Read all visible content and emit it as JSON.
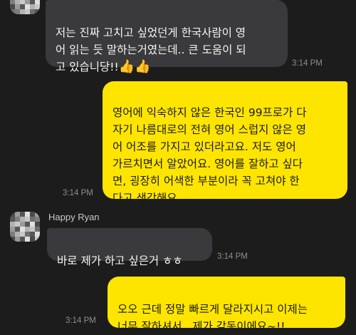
{
  "chat": {
    "messages": [
      {
        "direction": "incoming",
        "text": "저는 진짜 고치고 싶었던게 한국사람이 영\n어 읽는 듯 말하는거였는데.. 큰 도움이 되\n고 있습니당!!",
        "emoji": "👍👍",
        "time": "3:14 PM"
      },
      {
        "direction": "outgoing",
        "text": "영어에 익숙하지 않은 한국인 99프로가 다\n자기 나름대로의 전혀 영어 스럽지 않은 영\n어 어조를 가지고 있더라고요. 저도 영어\n가르치면서 알았어요.  영어를 잘하고 싶다\n면, 굉장히 어색한 부분이라 꼭 고쳐야 한\n다고 생각해요.",
        "time": "3:14 PM"
      },
      {
        "direction": "incoming",
        "sender": "Happy Ryan",
        "text": "바로 제가 하고 싶은거 ㅎㅎ",
        "time": "3:14 PM"
      },
      {
        "direction": "outgoing",
        "text": "오오 근데 정말 빠르게 달라지시고 이제는\n너무 잘하셔서.. 제가 감동이에요~!!",
        "time": "3:14 PM"
      }
    ]
  },
  "colors": {
    "background": "#1c1c1c",
    "incoming_bubble": "#3a3a3c",
    "outgoing_bubble": "#fee500",
    "timestamp": "#8e8e8e"
  }
}
